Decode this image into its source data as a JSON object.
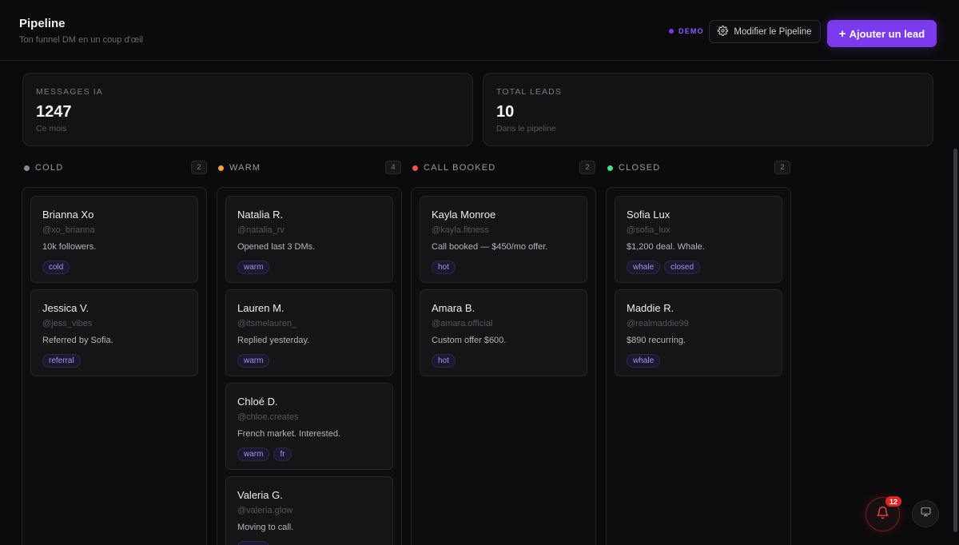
{
  "header": {
    "title": "Pipeline",
    "subtitle": "Ton funnel DM en un coup d'œil",
    "demo_label": "DEMO",
    "edit_button": "Modifier le Pipeline",
    "add_button": "Ajouter un lead",
    "add_button_icon": "+"
  },
  "stats": [
    {
      "label": "MESSAGES IA",
      "value": "1247",
      "sub": "Ce mois"
    },
    {
      "label": "TOTAL LEADS",
      "value": "10",
      "sub": "Dans le pipeline"
    }
  ],
  "columns": [
    {
      "name": "COLD",
      "count": "2",
      "color": "#8a8a90",
      "cards": [
        {
          "name": "Brianna Xo",
          "handle": "@xo_brianna",
          "note": "10k followers.",
          "tags": [
            "cold"
          ]
        },
        {
          "name": "Jessica V.",
          "handle": "@jess_vibes",
          "note": "Referred by Sofia.",
          "tags": [
            "referral"
          ]
        }
      ]
    },
    {
      "name": "WARM",
      "count": "4",
      "color": "#f59e4b",
      "cards": [
        {
          "name": "Natalia R.",
          "handle": "@natalia_rv",
          "note": "Opened last 3 DMs.",
          "tags": [
            "warm"
          ]
        },
        {
          "name": "Lauren M.",
          "handle": "@itsmelauren_",
          "note": "Replied yesterday.",
          "tags": [
            "warm"
          ]
        },
        {
          "name": "Chloé D.",
          "handle": "@chloe.creates",
          "note": "French market. Interested.",
          "tags": [
            "warm",
            "fr"
          ]
        },
        {
          "name": "Valeria G.",
          "handle": "@valeria.glow",
          "note": "Moving to call.",
          "tags": [
            "warm"
          ]
        }
      ]
    },
    {
      "name": "CALL BOOKED",
      "count": "2",
      "color": "#ef5350",
      "cards": [
        {
          "name": "Kayla Monroe",
          "handle": "@kayla.fitness",
          "note": "Call booked — $450/mo offer.",
          "tags": [
            "hot"
          ]
        },
        {
          "name": "Amara B.",
          "handle": "@amara.official",
          "note": "Custom offer $600.",
          "tags": [
            "hot"
          ]
        }
      ]
    },
    {
      "name": "CLOSED",
      "count": "2",
      "color": "#4ade80",
      "cards": [
        {
          "name": "Sofia Lux",
          "handle": "@sofia_lux",
          "note": "$1,200 deal. Whale.",
          "tags": [
            "whale",
            "closed"
          ]
        },
        {
          "name": "Maddie R.",
          "handle": "@realmaddie99",
          "note": "$890 recurring.",
          "tags": [
            "whale"
          ]
        }
      ]
    }
  ],
  "notifications": {
    "count": "12",
    "icon": "bell-icon"
  },
  "screen_button": {
    "icon": "monitor-icon"
  },
  "colors": {
    "accent": "#7c3aed",
    "background": "#0b0b0d",
    "danger": "#dc2626"
  }
}
